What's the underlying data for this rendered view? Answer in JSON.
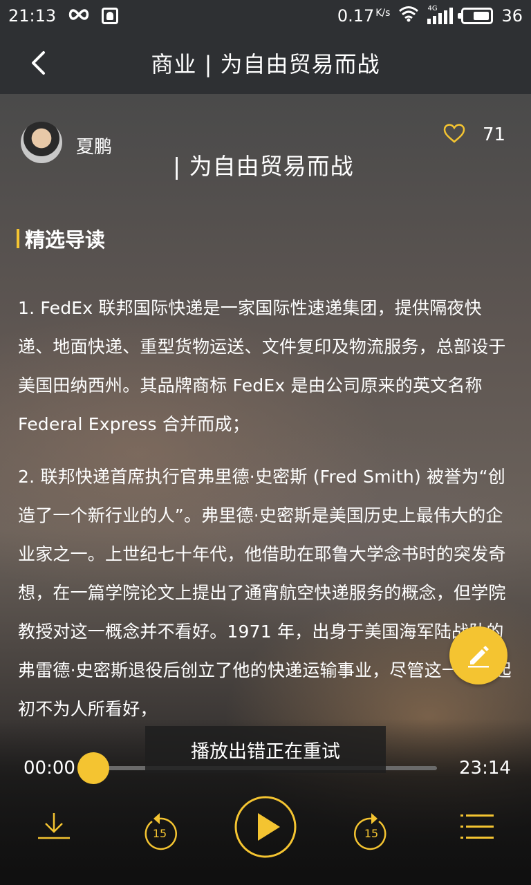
{
  "status_bar": {
    "time": "21:13",
    "network_speed": "0.17",
    "network_unit": "K/s",
    "network_type": "4G",
    "battery": "36",
    "icons": [
      "infinity-icon",
      "notification-icon",
      "wifi-icon",
      "signal-icon",
      "battery-icon"
    ]
  },
  "header": {
    "title": "商业 | 为自由贸易而战",
    "back_icon": "chevron-left-icon"
  },
  "article": {
    "author": "夏鹏",
    "likes": "71",
    "subtitle": "| 为自由贸易而战",
    "section_title": "精选导读",
    "paragraphs": [
      "1. FedEx 联邦国际快递是一家国际性速递集团，提供隔夜快递、地面快递、重型货物运送、文件复印及物流服务，总部设于美国田纳西州。其品牌商标 FedEx 是由公司原来的英文名称 Federal Express 合并而成；",
      "2. 联邦快递首席执行官弗里德·史密斯 (Fred Smith) 被誉为“创造了一个新行业的人”。弗里德·史密斯是美国历史上最伟大的企业家之一。上世纪七十年代，他借助在耶鲁大学念书时的突发奇想，在一篇学院论文上提出了通宵航空快递服务的概念，但学院教授对这一概念并不看好。1971 年，出身于美国海军陆战队的弗雷德·史密斯退役后创立了他的快递运输事业，尽管这一事业起初不为人所看好，"
    ]
  },
  "player": {
    "toast": "播放出错正在重试",
    "current_time": "00:00",
    "total_time": "23:14",
    "progress": 0,
    "rewind_seconds": "15",
    "forward_seconds": "15"
  },
  "colors": {
    "accent": "#f4c431",
    "bar_bg": "#2e3033"
  }
}
